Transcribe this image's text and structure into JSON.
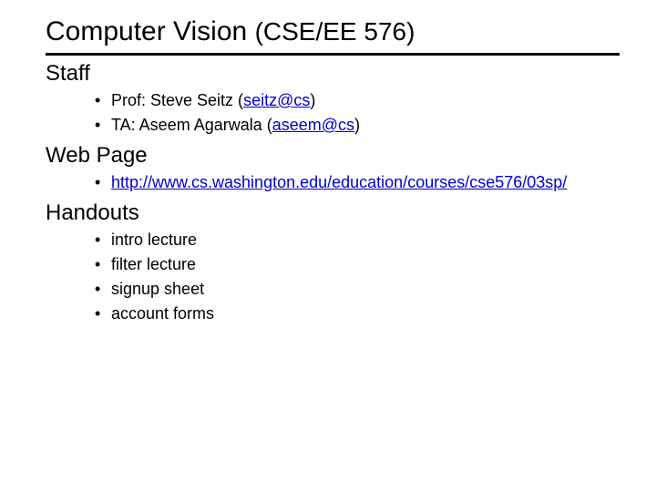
{
  "title_main": "Computer Vision",
  "title_sub": "(CSE/EE 576)",
  "sections": {
    "staff": {
      "heading": "Staff",
      "items": [
        {
          "prefix": "Prof:  Steve Seitz (",
          "link": "seitz@cs",
          "suffix": ")"
        },
        {
          "prefix": "TA:  Aseem Agarwala (",
          "link": "aseem@cs",
          "suffix": ")"
        }
      ]
    },
    "webpage": {
      "heading": "Web Page",
      "link": "http://www.cs.washington.edu/education/courses/cse576/03sp/"
    },
    "handouts": {
      "heading": "Handouts",
      "items": [
        "intro lecture",
        "filter lecture",
        "signup sheet",
        "account forms"
      ]
    }
  }
}
